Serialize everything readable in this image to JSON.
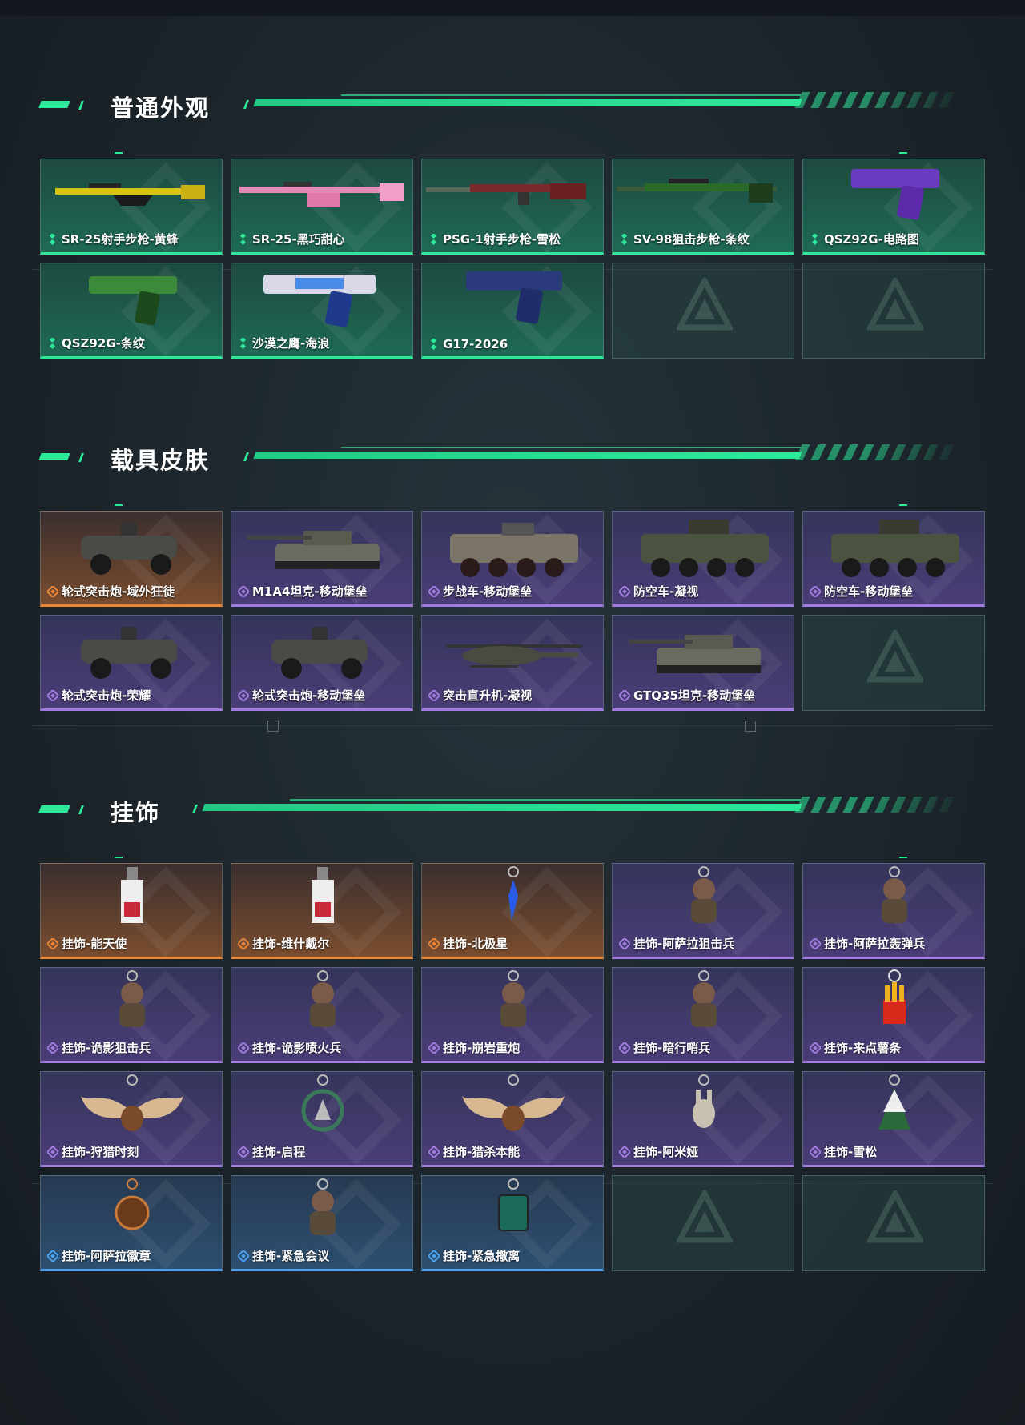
{
  "colors": {
    "accent": "#2ee89a",
    "rarity_green": "#2ee89a",
    "rarity_orange": "#e8873a",
    "rarity_purple": "#a27be0",
    "rarity_blue": "#4aa2f0"
  },
  "sections": [
    {
      "title": "普通外观",
      "items": [
        {
          "label": "SR-25射手步枪-黄蜂",
          "rarity": "green",
          "icon": "rifle-yellow-icon"
        },
        {
          "label": "SR-25-黑巧甜心",
          "rarity": "green",
          "icon": "rifle-pink-icon"
        },
        {
          "label": "PSG-1射手步枪-雪松",
          "rarity": "green",
          "icon": "rifle-red-icon"
        },
        {
          "label": "SV-98狙击步枪-条纹",
          "rarity": "green",
          "icon": "sniper-green-icon"
        },
        {
          "label": "QSZ92G-电路图",
          "rarity": "green",
          "icon": "pistol-purple-icon"
        },
        {
          "label": "QSZ92G-条纹",
          "rarity": "green",
          "icon": "pistol-green-icon"
        },
        {
          "label": "沙漠之鹰-海浪",
          "rarity": "green",
          "icon": "pistol-wave-icon"
        },
        {
          "label": "G17-2026",
          "rarity": "green",
          "icon": "pistol-navy-icon"
        }
      ]
    },
    {
      "title": "载具皮肤",
      "items": [
        {
          "label": "轮式突击炮-域外狂徒",
          "rarity": "orange",
          "icon": "buggy-icon"
        },
        {
          "label": "M1A4坦克-移动堡垒",
          "rarity": "purple",
          "icon": "tank-icon"
        },
        {
          "label": "步战车-移动堡垒",
          "rarity": "purple",
          "icon": "ifv-icon"
        },
        {
          "label": "防空车-凝视",
          "rarity": "purple",
          "icon": "aa-vehicle-icon"
        },
        {
          "label": "防空车-移动堡垒",
          "rarity": "purple",
          "icon": "aa-vehicle-icon"
        },
        {
          "label": "轮式突击炮-荣耀",
          "rarity": "purple",
          "icon": "buggy-icon"
        },
        {
          "label": "轮式突击炮-移动堡垒",
          "rarity": "purple",
          "icon": "buggy-icon"
        },
        {
          "label": "突击直升机-凝视",
          "rarity": "purple",
          "icon": "helicopter-icon"
        },
        {
          "label": "GTQ35坦克-移动堡垒",
          "rarity": "purple",
          "icon": "tank-icon"
        }
      ]
    },
    {
      "title": "挂饰",
      "items": [
        {
          "label": "挂饰-能天使",
          "rarity": "orange",
          "icon": "charm-tag-icon"
        },
        {
          "label": "挂饰-维什戴尔",
          "rarity": "orange",
          "icon": "charm-tag-icon"
        },
        {
          "label": "挂饰-北极星",
          "rarity": "orange",
          "icon": "charm-star-icon"
        },
        {
          "label": "挂饰-阿萨拉狙击兵",
          "rarity": "purple",
          "icon": "charm-figure-icon"
        },
        {
          "label": "挂饰-阿萨拉轰弹兵",
          "rarity": "purple",
          "icon": "charm-figure-icon"
        },
        {
          "label": "挂饰-诡影狙击兵",
          "rarity": "purple",
          "icon": "charm-figure-icon"
        },
        {
          "label": "挂饰-诡影喷火兵",
          "rarity": "purple",
          "icon": "charm-figure-icon"
        },
        {
          "label": "挂饰-崩岩重炮",
          "rarity": "purple",
          "icon": "charm-figure-icon"
        },
        {
          "label": "挂饰-暗行哨兵",
          "rarity": "purple",
          "icon": "charm-figure-icon"
        },
        {
          "label": "挂饰-来点薯条",
          "rarity": "purple",
          "icon": "charm-fries-icon"
        },
        {
          "label": "挂饰-狩猎时刻",
          "rarity": "purple",
          "icon": "charm-antler-icon"
        },
        {
          "label": "挂饰-启程",
          "rarity": "purple",
          "icon": "charm-medal-icon"
        },
        {
          "label": "挂饰-猎杀本能",
          "rarity": "purple",
          "icon": "charm-antler-icon"
        },
        {
          "label": "挂饰-阿米娅",
          "rarity": "purple",
          "icon": "charm-bunny-icon"
        },
        {
          "label": "挂饰-雪松",
          "rarity": "purple",
          "icon": "charm-tree-icon"
        },
        {
          "label": "挂饰-阿萨拉徽章",
          "rarity": "blue",
          "icon": "charm-badge-icon"
        },
        {
          "label": "挂饰-紧急会议",
          "rarity": "blue",
          "icon": "charm-figure-icon"
        },
        {
          "label": "挂饰-紧急撤离",
          "rarity": "blue",
          "icon": "charm-box-icon"
        }
      ]
    }
  ]
}
